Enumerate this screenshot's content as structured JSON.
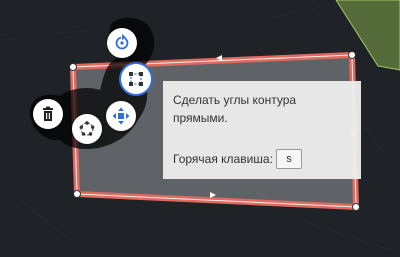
{
  "tooltip": {
    "description": "Сделать углы контура прямыми.",
    "hotkey_label": "Горячая клавиша:",
    "hotkey_key": "s"
  },
  "toolbar": {
    "buttons": [
      {
        "icon": "rotate-icon",
        "action": "Rotate"
      },
      {
        "icon": "square-corners-icon",
        "action": "Square corners"
      },
      {
        "icon": "move-icon",
        "action": "Move"
      },
      {
        "icon": "circularize-icon",
        "action": "Circularize"
      },
      {
        "icon": "delete-icon",
        "action": "Delete"
      }
    ]
  },
  "colors": {
    "background": "#1f2226",
    "area_fill": "#6b6e73",
    "area_outline": "#e06a5f",
    "accent_blue": "#2f6fe0",
    "land_area": "#556b3a"
  }
}
